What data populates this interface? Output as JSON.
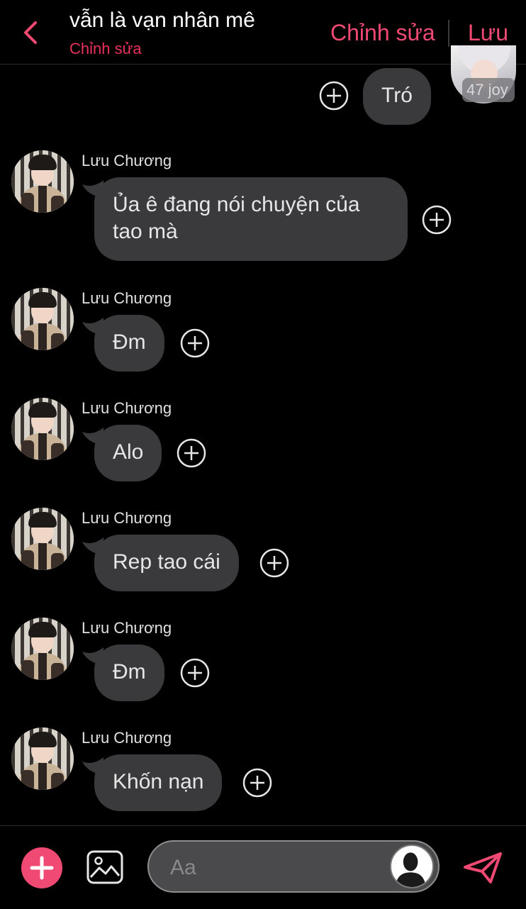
{
  "header": {
    "title": "vẫn là vạn nhân mê",
    "subtitle": "Chỉnh sửa",
    "edit_label": "Chỉnh sửa",
    "save_label": "Lưu",
    "accent_color": "#f04a74"
  },
  "top_message": {
    "text": "Tró",
    "badge": "47 joy"
  },
  "messages": [
    {
      "sender": "Lưu Chương",
      "line1": "Ủa ê đang nói chuyện của",
      "line2": "tao mà"
    },
    {
      "sender": "Lưu Chương",
      "line1": "Đm"
    },
    {
      "sender": "Lưu Chương",
      "line1": "Alo"
    },
    {
      "sender": "Lưu Chương",
      "line1": "Rep tao cái"
    },
    {
      "sender": "Lưu Chương",
      "line1": "Đm"
    },
    {
      "sender": "Lưu Chương",
      "line1": "Khốn nạn"
    }
  ],
  "composer": {
    "placeholder": "Aa",
    "icons": [
      "plus-icon",
      "image-icon",
      "user-icon",
      "send-icon"
    ]
  }
}
